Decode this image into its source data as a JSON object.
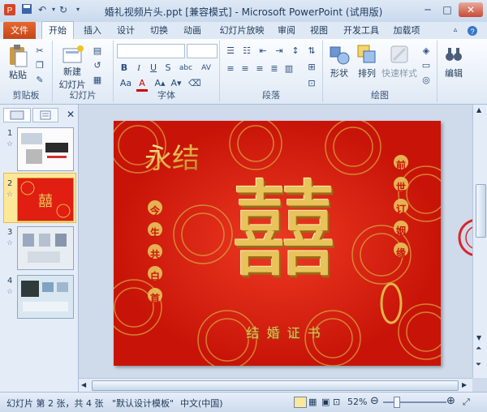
{
  "window": {
    "title": "婚礼视频片头.ppt [兼容模式] - Microsoft PowerPoint (试用版)"
  },
  "tabs": [
    "文件",
    "开始",
    "插入",
    "设计",
    "切换",
    "动画",
    "幻灯片放映",
    "审阅",
    "视图",
    "开发工具",
    "加载项"
  ],
  "ribbon": {
    "clipboard": {
      "paste": "粘贴",
      "label": "剪贴板"
    },
    "slides": {
      "new_slide_line1": "新建",
      "new_slide_line2": "幻灯片",
      "label": "幻灯片"
    },
    "font": {
      "label": "字体",
      "bold": "B",
      "italic": "I",
      "underline": "U",
      "strike": "S",
      "shadow": "abc",
      "spacing": "AV",
      "case": "Aa",
      "color": "A"
    },
    "paragraph": {
      "label": "段落"
    },
    "drawing": {
      "shapes": "形状",
      "arrange": "排列",
      "quick_styles": "快速样式",
      "label": "绘图"
    },
    "editing": {
      "label": "编辑"
    }
  },
  "slides": [
    {
      "num": "1",
      "star": "☆"
    },
    {
      "num": "2",
      "star": "☆"
    },
    {
      "num": "3",
      "star": "☆"
    },
    {
      "num": "4",
      "star": "☆"
    }
  ],
  "slide": {
    "big_char": "囍",
    "left_vertical": [
      "今",
      "生",
      "共",
      "白",
      "首"
    ],
    "right_vertical": [
      "前",
      "世",
      "订",
      "姻",
      "缘"
    ],
    "bottom_text": "结 婚 证 书",
    "colors": {
      "bg": "#e01e12",
      "gold": "#e8c25a"
    }
  },
  "status": {
    "slide_info": "幻灯片 第 2 张，共 4 张",
    "theme": "\"默认设计模板\"",
    "language": "中文(中国)",
    "zoom": "52%"
  }
}
